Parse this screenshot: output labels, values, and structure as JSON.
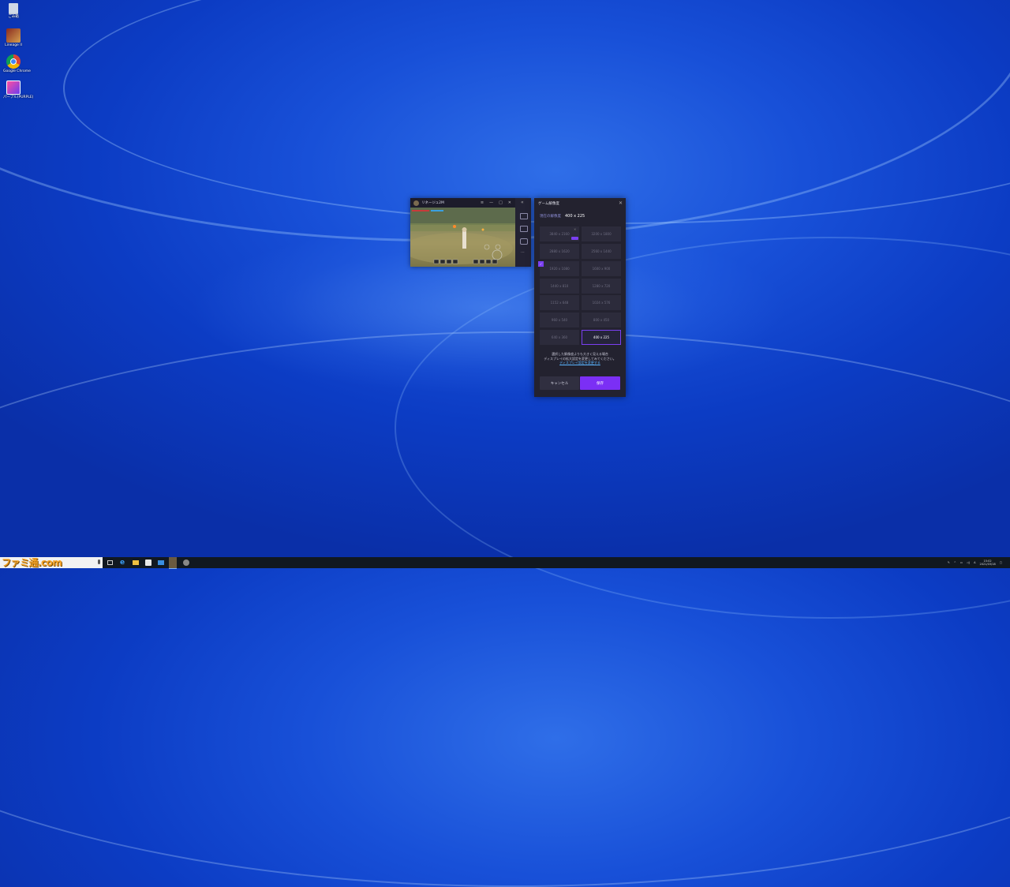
{
  "desktop": {
    "icons": [
      {
        "label": "ごみ箱"
      },
      {
        "label": "Lineage II"
      },
      {
        "label": "Google Chrome"
      },
      {
        "label": "パープル(PURPLE)"
      }
    ]
  },
  "game_window": {
    "title": "リネージュ2M",
    "controls": [
      "≡",
      "—",
      "□",
      "✕"
    ]
  },
  "dialog": {
    "title": "ゲーム解像度",
    "current_label": "現在の解像度",
    "current_value": "400 x 225",
    "resolutions": [
      "3840 x 2160",
      "3200 x 1800",
      "2880 x 1620",
      "2560 x 1440",
      "1920 x 1080",
      "1600 x 900",
      "1440 x 810",
      "1280 x 720",
      "1152 x 648",
      "1024 x 576",
      "960 x 540",
      "800 x 450",
      "640 x 360",
      "400 x 225"
    ],
    "selected": "400 x 225",
    "warning_line1": "選択した解像度よりも大きく見える場合",
    "warning_line2": "ディスプレイの拡大設定を変更してみてください。",
    "warning_link": "ディスプレイ設定を変更する",
    "cancel_label": "キャンセル",
    "save_label": "保存",
    "colors": {
      "accent": "#7b2ff5",
      "panel": "#23222f",
      "cell": "#2c2b3b"
    }
  },
  "taskbar": {
    "watermark": "ファミ通.com",
    "time": "15:02",
    "date": "2021/03/18"
  }
}
